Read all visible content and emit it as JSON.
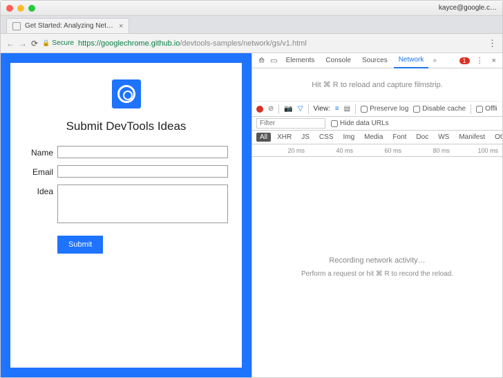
{
  "browser": {
    "user": "kayce@google.c…",
    "tab": {
      "title": "Get Started: Analyzing Netwo"
    },
    "address": {
      "secure_label": "Secure",
      "scheme": "https",
      "host": "googlechrome.github.io",
      "path": "/devtools-samples/network/gs/v1.html"
    }
  },
  "page": {
    "heading": "Submit DevTools Ideas",
    "labels": {
      "name": "Name",
      "email": "Email",
      "idea": "Idea"
    },
    "submit": "Submit"
  },
  "devtools": {
    "tabs": {
      "elements": "Elements",
      "console": "Console",
      "sources": "Sources",
      "network": "Network"
    },
    "errors": "1",
    "filmstrip_hint": "Hit ⌘ R to reload and capture filmstrip.",
    "toolbar": {
      "view_label": "View:",
      "preserve_log": "Preserve log",
      "disable_cache": "Disable cache",
      "offline": "Offli"
    },
    "filter": {
      "placeholder": "Filter",
      "hide_data_urls": "Hide data URLs"
    },
    "types": [
      "All",
      "XHR",
      "JS",
      "CSS",
      "Img",
      "Media",
      "Font",
      "Doc",
      "WS",
      "Manifest",
      "Other"
    ],
    "timeline": [
      "20 ms",
      "40 ms",
      "60 ms",
      "80 ms",
      "100 ms"
    ],
    "recording": {
      "line1": "Recording network activity…",
      "line2": "Perform a request or hit ⌘ R to record the reload."
    }
  }
}
